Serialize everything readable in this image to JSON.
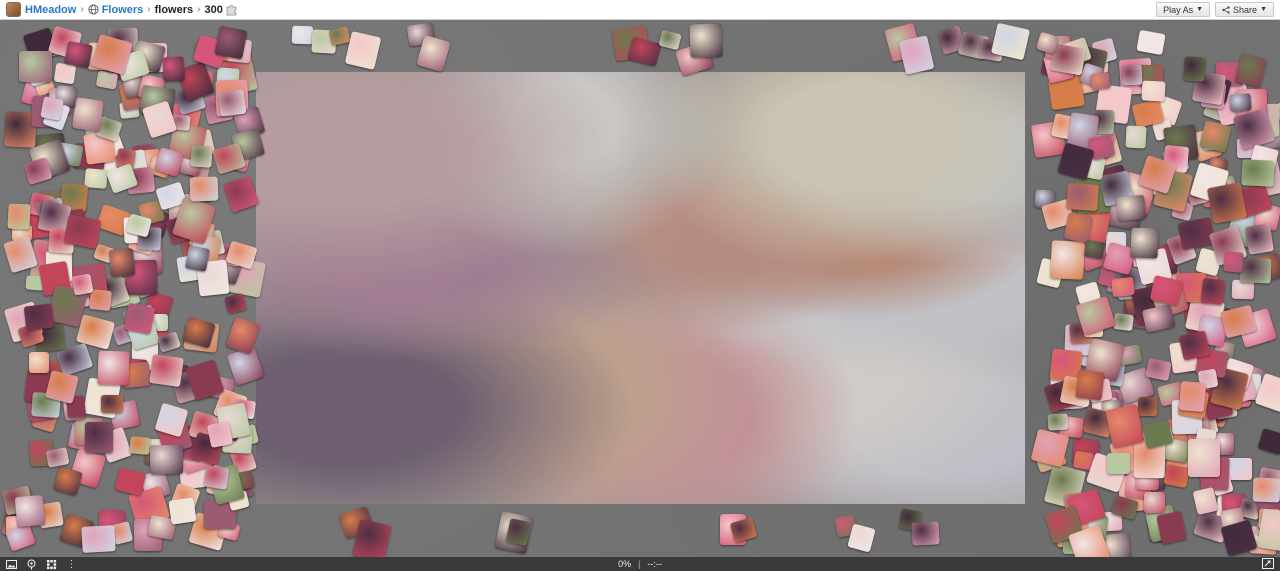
{
  "breadcrumb": {
    "user": "HMeadow",
    "category": "Flowers",
    "puzzle": "flowers",
    "pieces": "300"
  },
  "toolbar": {
    "play_as_label": "Play As",
    "share_label": "Share"
  },
  "status": {
    "progress": "0%",
    "progress_value": 0,
    "timer": "--:--"
  },
  "icons": {
    "avatar": "user-avatar",
    "globe": "globe-icon",
    "puzzle": "puzzle-piece-icon",
    "share": "share-icon",
    "image": "image-preview-icon",
    "ghost": "ghost-toggle-icon",
    "scatter": "scatter-pieces-icon",
    "menu": "more-menu-icon",
    "fullscreen": "fullscreen-icon"
  },
  "colors": {
    "link": "#2b78c5",
    "board": "#737373",
    "bottombar": "#3a3a3a"
  }
}
